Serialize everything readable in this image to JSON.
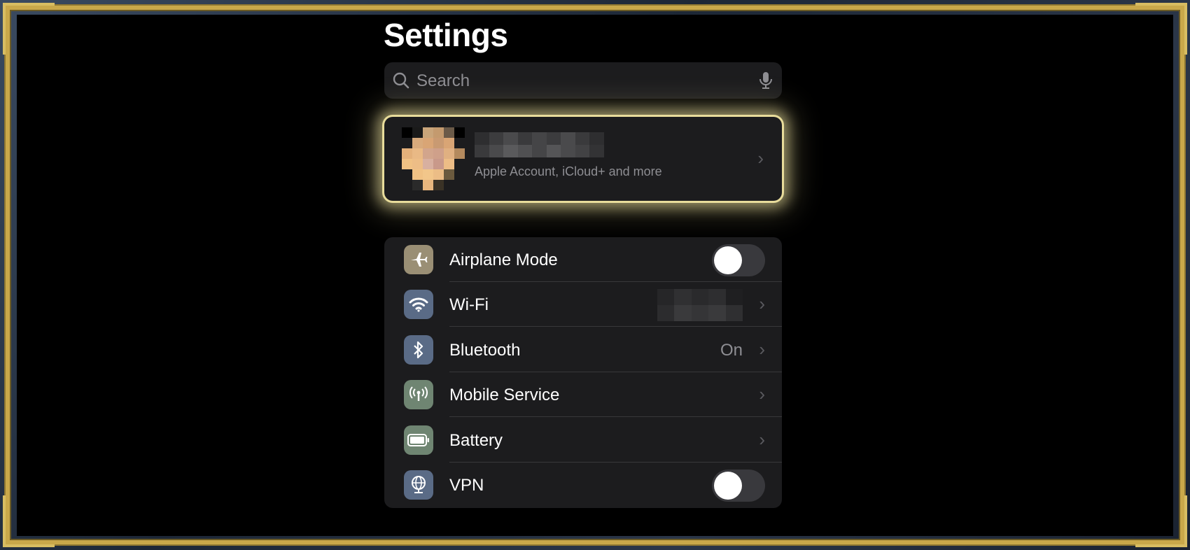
{
  "page": {
    "title": "Settings"
  },
  "search": {
    "placeholder": "Search",
    "search_icon": "search-icon",
    "mic_icon": "microphone-icon"
  },
  "account": {
    "subtitle": "Apple Account, iCloud+ and more",
    "name_obscured": true,
    "avatar_obscured": true,
    "highlight_color": "#e8dc9b"
  },
  "settings": {
    "airplane": {
      "label": "Airplane Mode",
      "icon": "airplane-icon",
      "icon_bg": "#9a8f75",
      "toggle_on": false
    },
    "wifi": {
      "label": "Wi-Fi",
      "icon": "wifi-icon",
      "icon_bg": "#5a6b86",
      "value_obscured": true
    },
    "bluetooth": {
      "label": "Bluetooth",
      "icon": "bluetooth-icon",
      "icon_bg": "#5a6b86",
      "value": "On"
    },
    "mobile": {
      "label": "Mobile Service",
      "icon": "antenna-icon",
      "icon_bg": "#6f8572"
    },
    "battery": {
      "label": "Battery",
      "icon": "battery-icon",
      "icon_bg": "#6f8572"
    },
    "vpn": {
      "label": "VPN",
      "icon": "globe-icon",
      "icon_bg": "#5a6b86",
      "toggle_on": false
    }
  },
  "chevron": "›"
}
